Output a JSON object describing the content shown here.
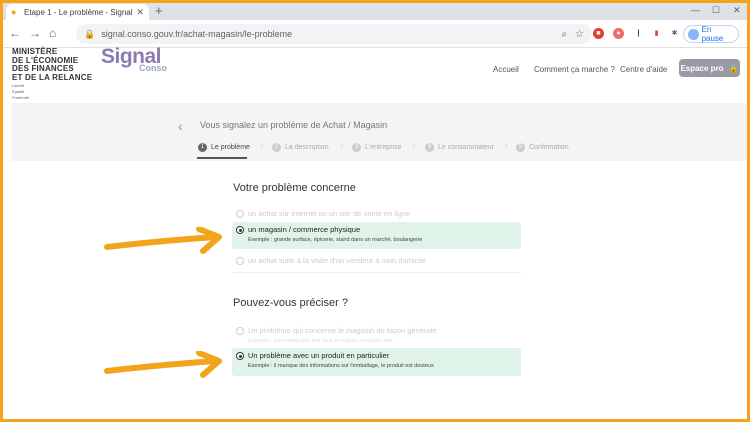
{
  "browser": {
    "tab_title": "Etape 1 - Le problème - SignalC...",
    "tab_close": "✕",
    "new_tab": "+",
    "url": "signal.conso.gouv.fr/achat-magasin/le-probleme",
    "profile_label": "En pause"
  },
  "header": {
    "ministry_lines": [
      "MINISTÈRE",
      "DE L'ÉCONOMIE",
      "DES FINANCES",
      "ET DE LA RELANCE"
    ],
    "ministry_motto": [
      "Liberté",
      "Égalité",
      "Fraternité"
    ],
    "logo_main": "Signal",
    "logo_sub": "Conso",
    "nav": [
      "Accueil",
      "Comment ça marche ?",
      "Centre d'aide"
    ],
    "espace_pro": "Espace pro"
  },
  "stepper": {
    "title": "Vous signalez un problème de Achat / Magasin",
    "steps": [
      {
        "num": "1",
        "label": "Le problème"
      },
      {
        "num": "2",
        "label": "La description"
      },
      {
        "num": "3",
        "label": "L'entreprise"
      },
      {
        "num": "4",
        "label": "Le consommateur"
      },
      {
        "num": "5",
        "label": "Confirmation"
      }
    ]
  },
  "q1": {
    "title": "Votre problème concerne",
    "options": [
      {
        "label": "un achat sur internet ou un site de vente en ligne",
        "example": ""
      },
      {
        "label": "un magasin / commerce physique",
        "example": "Exemple : grande surface, épicerie, stand dans un marché, boulangerie"
      },
      {
        "label": "un achat suite à la visite d'un vendeur à mon domicile",
        "example": ""
      }
    ]
  },
  "q2": {
    "title": "Pouvez-vous préciser ?",
    "options": [
      {
        "label": "Un problème qui concerne le magasin de façon générale",
        "example": "Exemple : prix manquant, prix faux en caisse, magasin sale"
      },
      {
        "label": "Un problème avec un produit en particulier",
        "example": "Exemple : il manque des informations sur l'emballage, le produit est douteux"
      }
    ]
  },
  "colors": {
    "border": "#f2a51a",
    "arrow": "#f2a51a",
    "selected_bg": "#dff3e8"
  }
}
